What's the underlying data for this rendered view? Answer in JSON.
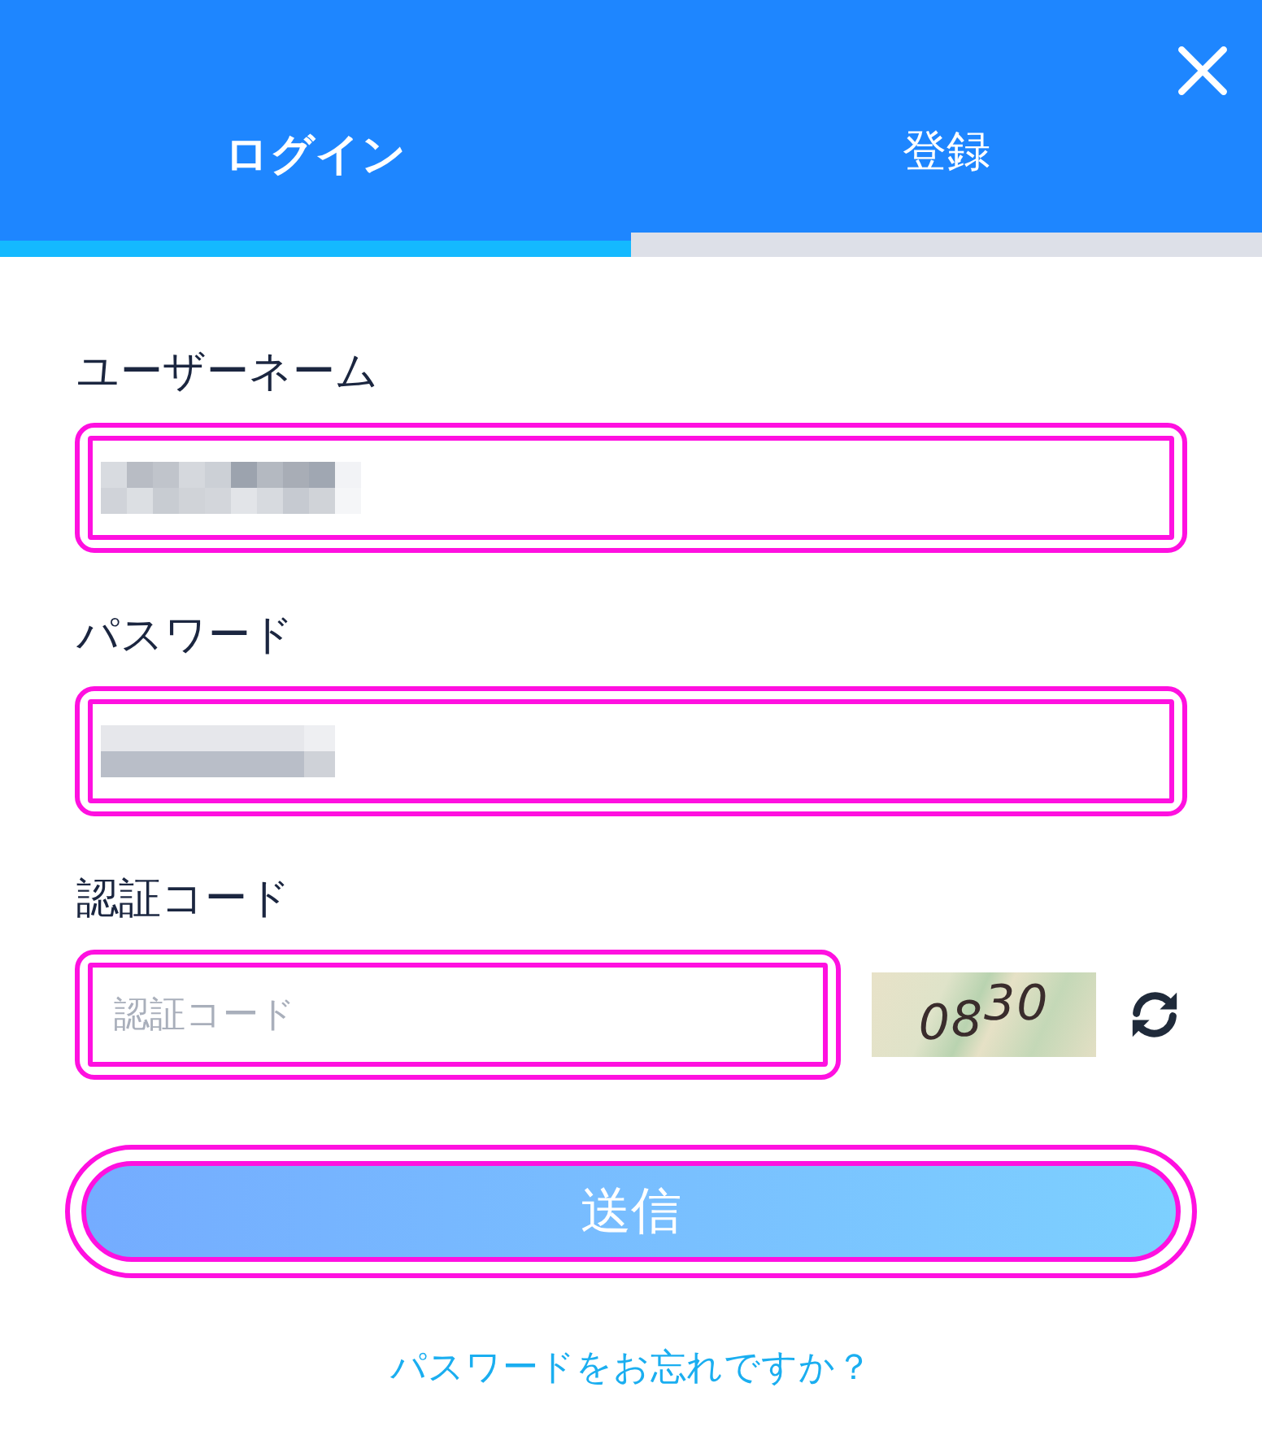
{
  "tabs": [
    {
      "label": "ログイン",
      "selected": true
    },
    {
      "label": "登録",
      "selected": false
    }
  ],
  "form": {
    "fields": [
      {
        "label": "ユーザーネーム",
        "kind": "text",
        "redacted": true,
        "highlighted": true
      },
      {
        "label": "パスワード",
        "kind": "password",
        "redacted": true,
        "highlighted": true
      },
      {
        "label": "認証コード",
        "kind": "captcha",
        "placeholder": "認証コード",
        "captcha_code": "0830",
        "highlighted": true
      }
    ],
    "submit_button": {
      "label": "送信",
      "highlighted": true
    },
    "forgot_password_link": "パスワードをお忘れですか？"
  }
}
